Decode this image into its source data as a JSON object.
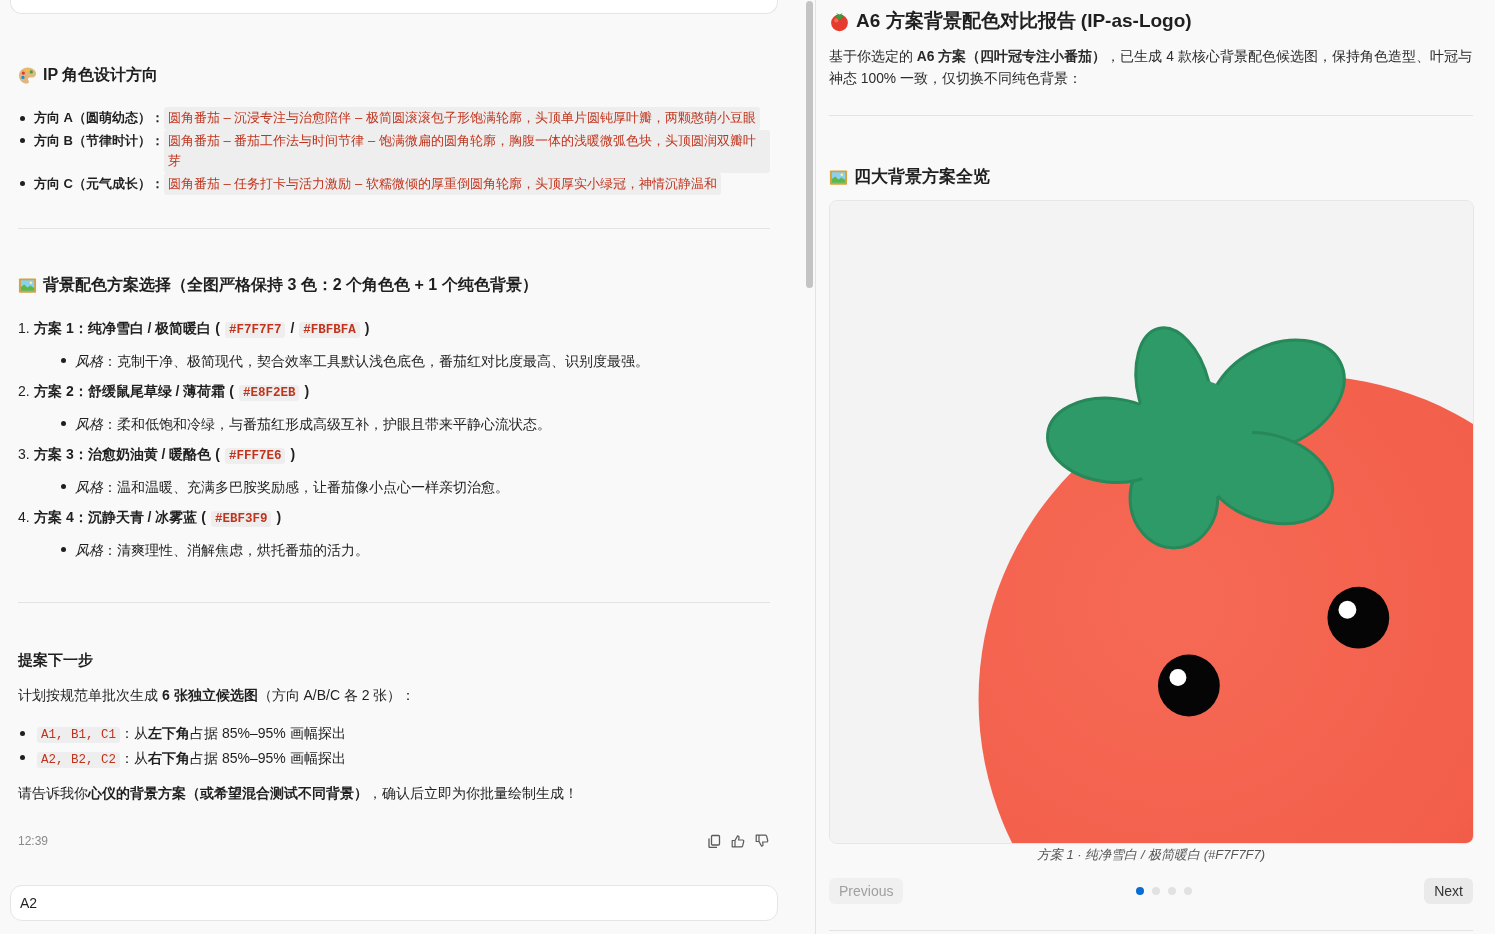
{
  "chat": {
    "design_section": {
      "title": "IP 角色设计方向",
      "items": [
        {
          "label": "方向 A（圆萌幼态）：",
          "code": "圆角番茄 – 沉浸专注与治愈陪伴 – 极简圆滚滚包子形饱满轮廓，头顶单片圆钝厚叶瓣，两颗憨萌小豆眼"
        },
        {
          "label": "方向 B（节律时计）：",
          "code": "圆角番茄 – 番茄工作法与时间节律 – 饱满微扁的圆角轮廓，胸腹一体的浅暖微弧色块，头顶圆润双瓣叶芽"
        },
        {
          "label": "方向 C（元气成长）：",
          "code": "圆角番茄 – 任务打卡与活力激励 – 软糯微倾的厚重倒圆角轮廓，头顶厚实小绿冠，神情沉静温和"
        }
      ]
    },
    "background_section": {
      "title": "背景配色方案选择（全图严格保持 3 色：2 个角色色 + 1 个纯色背景）",
      "options": [
        {
          "number": "1.",
          "parts": [
            {
              "kind": "text",
              "text": "方案 1：纯净雪白 / 极简暖白 ("
            },
            {
              "kind": "code",
              "text": "#F7F7F7"
            },
            {
              "kind": "text",
              "text": "/"
            },
            {
              "kind": "code",
              "text": "#FBFBFA"
            },
            {
              "kind": "text",
              "text": ")"
            }
          ],
          "note": "*风格*：克制干净、极简现代，契合效率工具默认浅色底色，番茄红对比度最高、识别度最强。"
        },
        {
          "number": "2.",
          "parts": [
            {
              "kind": "text",
              "text": "方案 2：舒缓鼠尾草绿 / 薄荷霜 ("
            },
            {
              "kind": "code",
              "text": "#E8F2EB"
            },
            {
              "kind": "text",
              "text": ")"
            }
          ],
          "note": "*风格*：柔和低饱和冷绿，与番茄红形成高级互补，护眼且带来平静心流状态。"
        },
        {
          "number": "3.",
          "parts": [
            {
              "kind": "text",
              "text": "方案 3：治愈奶油黄 / 暖酪色 ("
            },
            {
              "kind": "code",
              "text": "#FFF7E6"
            },
            {
              "kind": "text",
              "text": ")"
            }
          ],
          "note": "*风格*：温和温暖、充满多巴胺奖励感，让番茄像小点心一样亲切治愈。"
        },
        {
          "number": "4.",
          "parts": [
            {
              "kind": "text",
              "text": "方案 4：沉静天青 / 冰雾蓝 ("
            },
            {
              "kind": "code",
              "text": "#EBF3F9"
            },
            {
              "kind": "text",
              "text": ")"
            }
          ],
          "note": "*风格*：清爽理性、消解焦虑，烘托番茄的活力。"
        }
      ]
    },
    "next_steps": {
      "title": "提案下一步",
      "intro": "计划按规范单批次生成 **6 张独立候选图**（方向 A/B/C 各 2 张）：",
      "items": [
        {
          "code": "A1, B1, C1",
          "text": "：从**左下角**占据 85%–95% 画幅探出"
        },
        {
          "code": "A2, B2, C2",
          "text": "：从**右下角**占据 85%–95% 画幅探出"
        }
      ],
      "closing": "请告诉我你**心仪的背景方案（或希望混合测试不同背景）**，确认后立即为你批量绘制生成！"
    },
    "timestamp": "12:39",
    "user_message": "A2"
  },
  "report": {
    "title": "A6 方案背景配色对比报告 (IP-as-Logo)",
    "intro": "基于你选定的 **A6 方案（四叶冠专注小番茄）**，已生成 4 款核心背景配色候选图，保持角色造型、叶冠与神态 100% 一致，仅切换不同纯色背景：",
    "gallery_heading": "四大背景方案全览",
    "carousel": {
      "caption": "方案 1 · 纯净雪白 / 极简暖白 (#F7F7F7)",
      "previous": {
        "label": "Previous",
        "disabled": true
      },
      "next": {
        "label": "Next",
        "disabled": false
      },
      "pages": [
        {
          "selected": true
        },
        {
          "selected": false
        },
        {
          "selected": false
        },
        {
          "selected": false
        }
      ]
    }
  }
}
